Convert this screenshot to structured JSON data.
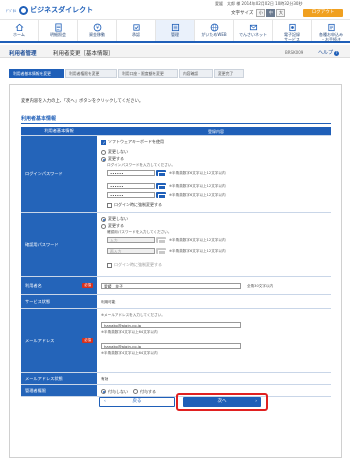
{
  "header": {
    "logo_sub": "ﾃﾞｼﾞﾀﾙ",
    "logo_text": "ビジネスダイレクト",
    "user_line": "愛媛　太郎 様 2014年02月02日 10時32分30秒",
    "user_name": "愛媛　太郎",
    "font_size_label": "文字サイズ",
    "font_small": "小",
    "font_medium": "中",
    "font_large": "大",
    "logout_label": "ログアウト"
  },
  "nav": [
    {
      "label": "ホーム",
      "icon": "home-icon"
    },
    {
      "label": "明細照会",
      "icon": "statement-icon"
    },
    {
      "label": "資金移動",
      "icon": "transfer-icon"
    },
    {
      "label": "承認",
      "icon": "approval-icon"
    },
    {
      "label": "管理",
      "icon": "management-icon"
    },
    {
      "label": "がいためWEB",
      "icon": "forex-icon"
    },
    {
      "label": "でんさいネット",
      "icon": "densai-icon"
    },
    {
      "label": "電子記録\nサービス",
      "icon": "ekiroku-icon"
    },
    {
      "label": "各種お申込み\n・お手続き",
      "icon": "application-icon"
    }
  ],
  "titlebar": {
    "section": "利用者管理",
    "page": "利用者変更［基本情報］",
    "code": "BRSK009",
    "help": "ヘルプ"
  },
  "steps": [
    "利用者基本情報を変更",
    "利用者権限を変更",
    "利用口座・限度額を変更",
    "内容確認",
    "変更完了"
  ],
  "intro": "変更内容を入力の上、「次へ」ボタンをクリックしてください。",
  "section_title": "利用者基本情報",
  "table_head": {
    "item": "利用者基本情報",
    "content": "登録内容"
  },
  "login_pw": {
    "label": "ログインパスワード",
    "software_kbd": "ソフトウェアキーボードを使用",
    "no_change": "変更しない",
    "change": "変更する",
    "instruction": "ログインパスワードを入力してください。",
    "current_label": "現在の",
    "current_value": "••••••",
    "new_value": "••••••",
    "confirm_value": "••••••",
    "note1": "※半角英数字6文字以上12文字以内",
    "note2": "※半角英数字6文字以上12文字以内",
    "note3": "※半角英数字6文字以上12文字以内",
    "change_next_login": "ログイン時に強制変更する"
  },
  "confirm_pw": {
    "label": "確認用パスワード",
    "no_change": "変更しない",
    "change": "変更する",
    "instruction": "確認用パスワードを入力してください。",
    "input_label": "入力",
    "reinput_label": "再入力",
    "note1": "※半角英数字6文字以上12文字以内",
    "note2": "※半角英数字6文字以上12文字以内",
    "change_next_login": "ログイン時に強制変更する"
  },
  "user_name": {
    "label": "利用者名",
    "required": "必須",
    "value": "愛媛　花子",
    "note": "全角30文字以内"
  },
  "service_status": {
    "label": "サービス状態",
    "value": "利用可能"
  },
  "email": {
    "label": "メールアドレス",
    "required": "必須",
    "instruction": "※メールアドレスを入力してください。",
    "value1": "hanako@aigin.co.jp",
    "note1": "※半角英数字4文字以上64文字以内",
    "value2": "hanako@aigin.co.jp",
    "note2": "※半角英数字4文字以上64文字以内"
  },
  "email_status": {
    "label": "メールアドレス状態",
    "value": "有効"
  },
  "admin_auth": {
    "label": "管理者権限",
    "no": "付与しない",
    "yes": "付与する"
  },
  "buttons": {
    "back": "戻る",
    "next": "次へ"
  },
  "colors": {
    "primary": "#1f5fb8",
    "accent": "#f0a020",
    "highlight": "#e02020"
  }
}
